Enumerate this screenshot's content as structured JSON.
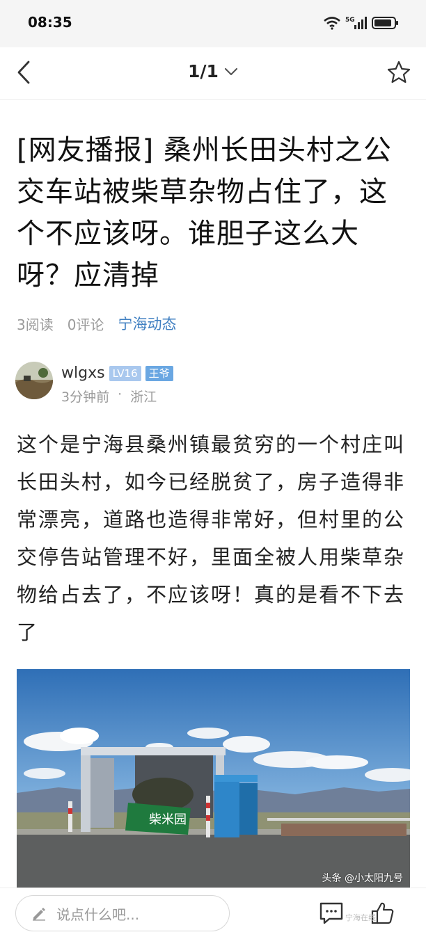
{
  "status_bar": {
    "time": "08:35",
    "network": "5G"
  },
  "nav": {
    "page_indicator": "1/1"
  },
  "article": {
    "title": "[网友播报] 桑州长田头村之公交车站被柴草杂物占住了，这个不应该呀。谁胆子这么大呀？应清掉",
    "reads": "3阅读",
    "comments": "0评论",
    "channel": "宁海动态"
  },
  "author": {
    "name": "wlgxs",
    "level": "LV16",
    "title_badge": "王爷",
    "time_ago": "3分钟前",
    "separator": "·",
    "location": "浙江"
  },
  "body": {
    "text": "这个是宁海县桑州镇最贫穷的一个村庄叫长田头村，如今已经脱贫了，房子造得非常漂亮，道路也造得非常好，但村里的公交停告站管理不好，里面全被人用柴草杂物给占去了，不应该呀！真的是看不下去了"
  },
  "photo": {
    "watermark": "头条 @小太阳九号",
    "sign_text": "柴米园"
  },
  "bottom_bar": {
    "comment_placeholder": "说点什么吧...",
    "corner_watermark": "宁海在线"
  },
  "colors": {
    "accent": "#3f7fc1",
    "badge_level": "#a9c8ee",
    "badge_title": "#6aa7e2"
  },
  "icons": [
    "back-icon",
    "chevron-down-icon",
    "star-icon",
    "wifi-icon",
    "signal-icon",
    "battery-icon",
    "pen-icon",
    "comment-icon",
    "like-icon"
  ]
}
